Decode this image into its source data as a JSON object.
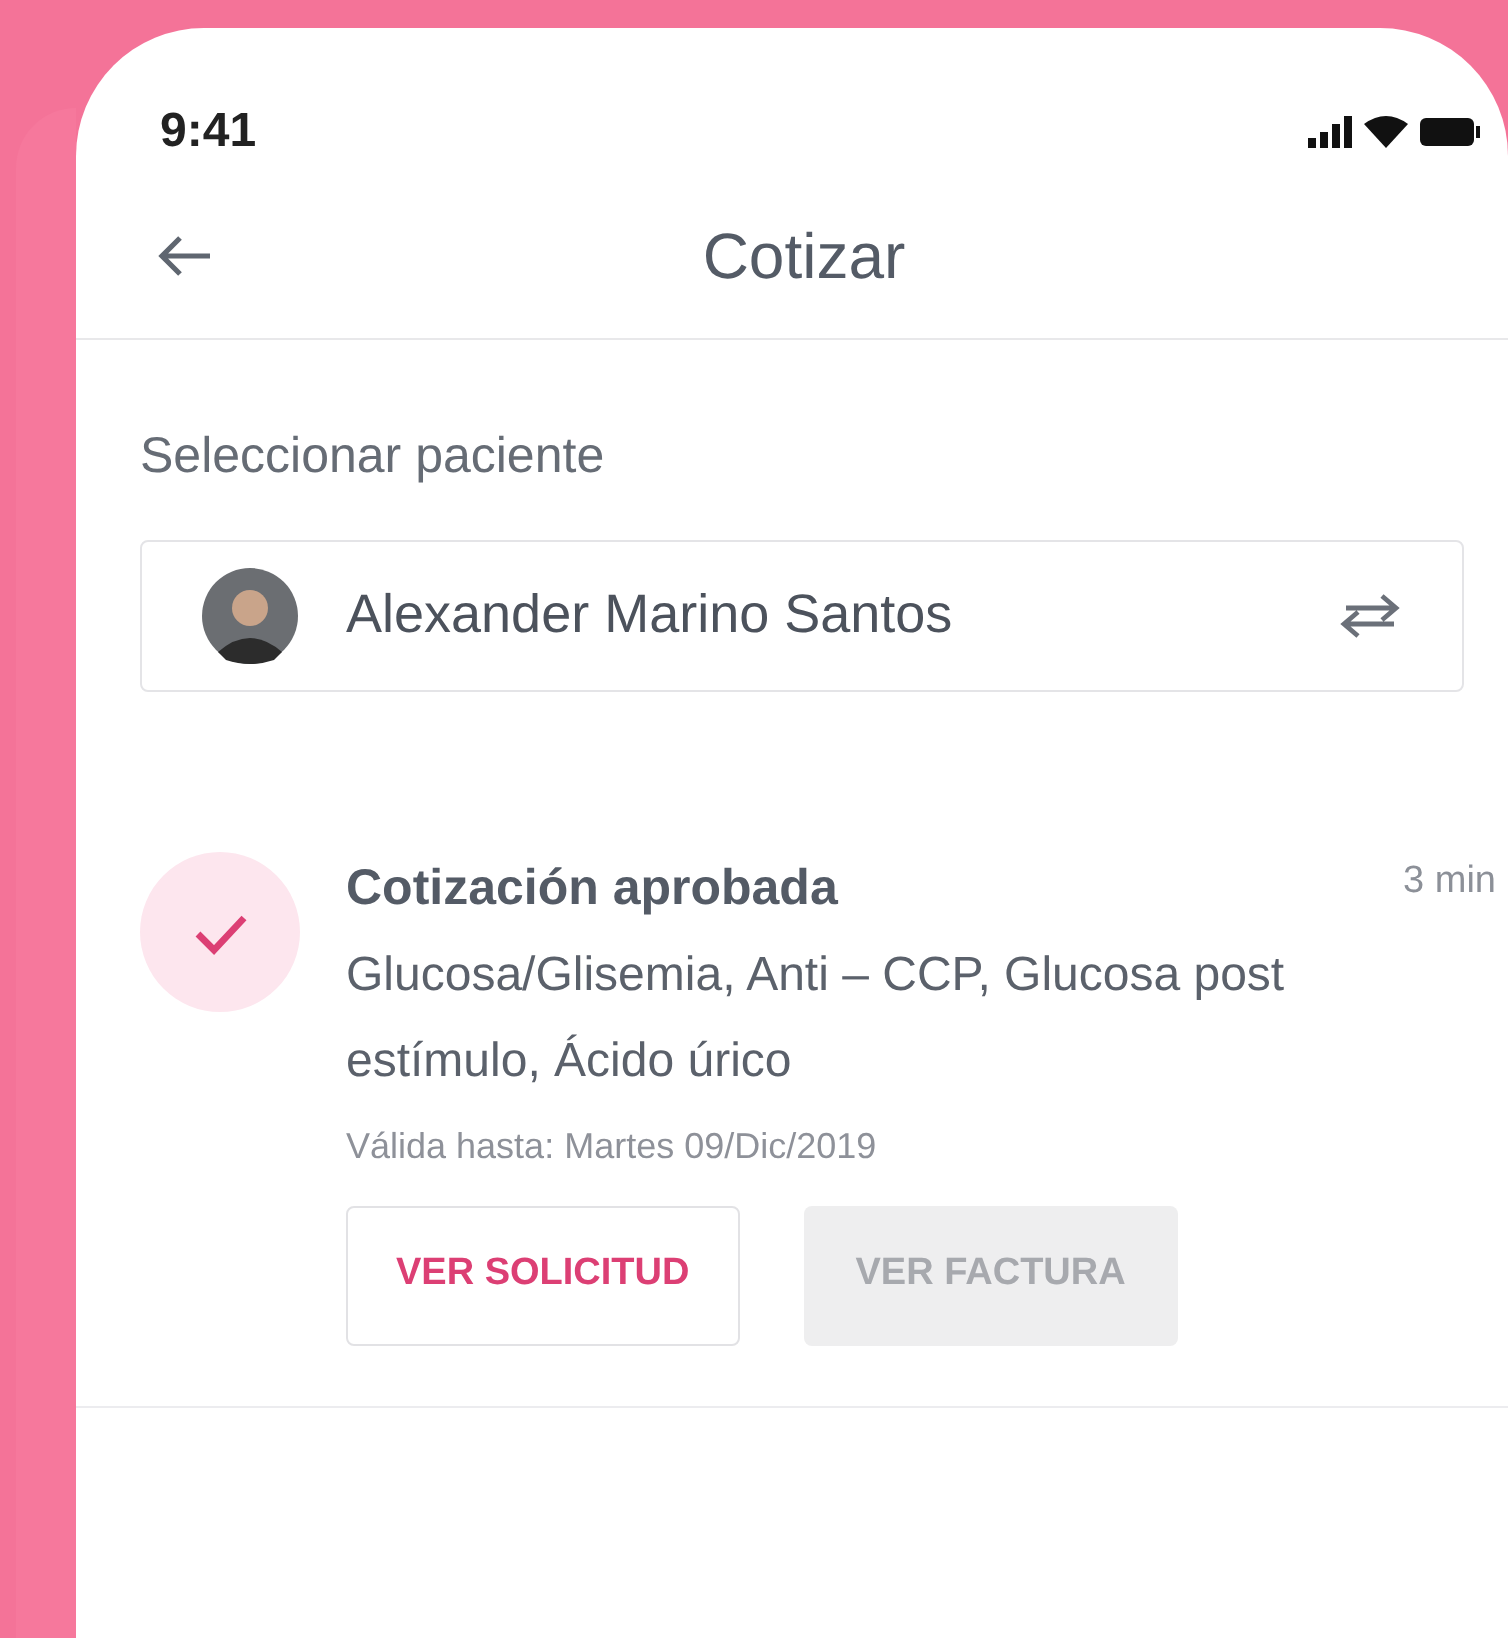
{
  "status_bar": {
    "time": "9:41"
  },
  "header": {
    "title": "Cotizar"
  },
  "patient_section": {
    "label": "Seleccionar paciente",
    "patient_name": "Alexander Marino Santos"
  },
  "quotes": [
    {
      "title": "Cotización aprobada",
      "time": "3 min",
      "tests": "Glucosa/Glisemia, Anti – CCP, Glucosa post estímulo, Ácido úrico",
      "valid_until": "Válida hasta: Martes 09/Dic/2019",
      "buttons": [
        {
          "label": "VER SOLICITUD",
          "disabled": false
        },
        {
          "label": "VER FACTURA",
          "disabled": true
        }
      ]
    }
  ]
}
